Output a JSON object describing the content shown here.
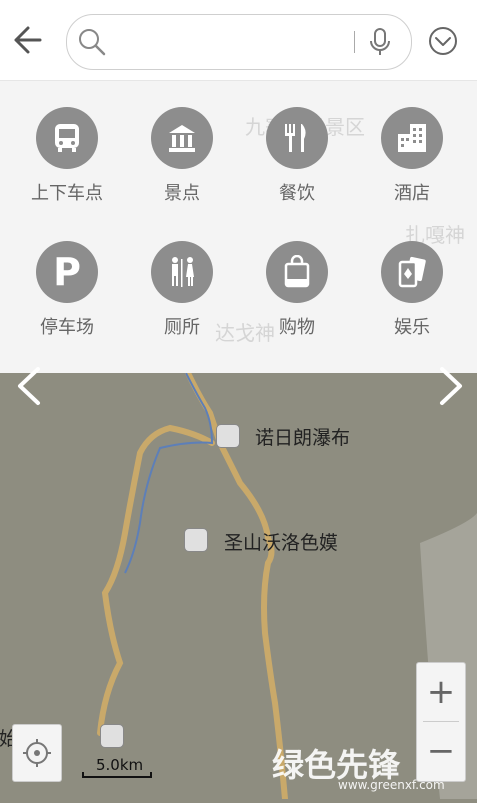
{
  "search": {
    "placeholder": ""
  },
  "categories": [
    {
      "label": "上下车点",
      "icon": "bus-icon"
    },
    {
      "label": "景点",
      "icon": "landmark-icon"
    },
    {
      "label": "餐饮",
      "icon": "fork-knife-icon"
    },
    {
      "label": "酒店",
      "icon": "hotel-icon"
    },
    {
      "label": "停车场",
      "icon": "parking-icon"
    },
    {
      "label": "厕所",
      "icon": "restroom-icon"
    },
    {
      "label": "购物",
      "icon": "shopping-bag-icon"
    },
    {
      "label": "娱乐",
      "icon": "playing-cards-icon"
    }
  ],
  "map": {
    "faint_labels": [
      "九寨沟风景区",
      "扎嘎神",
      "达戈神"
    ],
    "pois": [
      {
        "label": "诺日朗瀑布",
        "icon": "waterfall-icon"
      },
      {
        "label": "圣山沃洛色嫫",
        "icon": "mountain-icon"
      },
      {
        "label": "原始森林",
        "icon": "pavilion-icon"
      }
    ],
    "scale_label": "5.0km"
  },
  "watermark": {
    "text": "绿色先锋",
    "url_text": "www.greenxf.com"
  },
  "colors": {
    "map_bg": "#8e8d80",
    "route": "#c9a96a",
    "river": "#5d7fb8",
    "icon_circle": "#8d8d8d"
  }
}
